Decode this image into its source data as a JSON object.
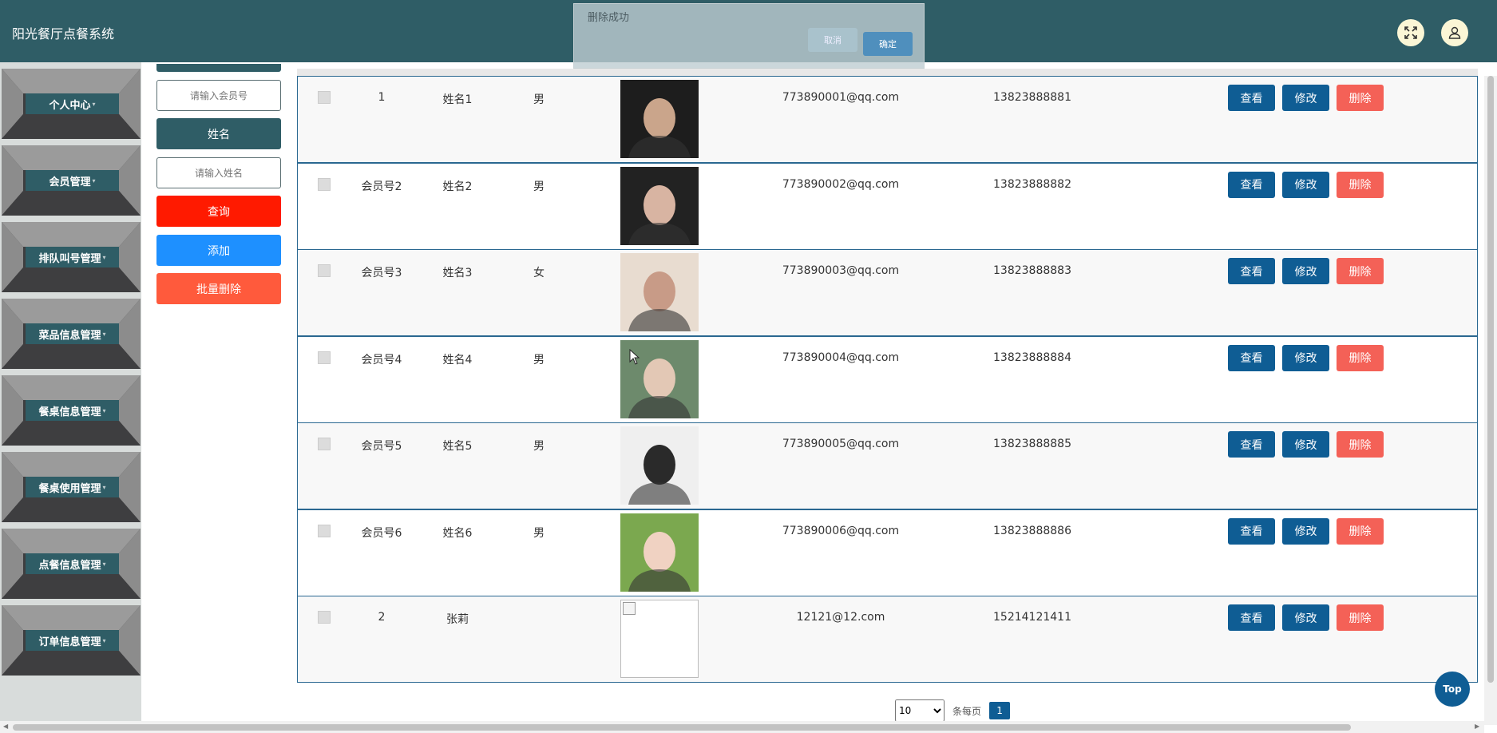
{
  "header": {
    "title": "阳光餐厅点餐系统",
    "icons": [
      "fullscreen-icon",
      "user-icon"
    ]
  },
  "sidebar": {
    "items": [
      {
        "label": "个人中心"
      },
      {
        "label": "会员管理"
      },
      {
        "label": "排队叫号管理"
      },
      {
        "label": "菜品信息管理"
      },
      {
        "label": "餐桌信息管理"
      },
      {
        "label": "餐桌使用管理"
      },
      {
        "label": "点餐信息管理"
      },
      {
        "label": "订单信息管理"
      }
    ]
  },
  "search": {
    "member_placeholder": "请输入会员号",
    "name_label": "姓名",
    "name_placeholder": "请输入姓名",
    "query_label": "查询",
    "add_label": "添加",
    "batch_delete_label": "批量删除"
  },
  "colors": {
    "primary": "#2f5d66",
    "query": "#ff1a00",
    "add": "#1e90ff",
    "batch_delete": "#ff5a3c",
    "action": "#0f5d94",
    "delete": "#f46157"
  },
  "table": {
    "rows": [
      {
        "member_no": "1",
        "name": "姓名1",
        "gender": "男",
        "email": "773890001@qq.com",
        "phone": "13823888881",
        "photo": "person-photo"
      },
      {
        "member_no": "会员号2",
        "name": "姓名2",
        "gender": "男",
        "email": "773890002@qq.com",
        "phone": "13823888882",
        "photo": "person-photo"
      },
      {
        "member_no": "会员号3",
        "name": "姓名3",
        "gender": "女",
        "email": "773890003@qq.com",
        "phone": "13823888883",
        "photo": "person-photo"
      },
      {
        "member_no": "会员号4",
        "name": "姓名4",
        "gender": "男",
        "email": "773890004@qq.com",
        "phone": "13823888884",
        "photo": "person-photo"
      },
      {
        "member_no": "会员号5",
        "name": "姓名5",
        "gender": "男",
        "email": "773890005@qq.com",
        "phone": "13823888885",
        "photo": "person-photo"
      },
      {
        "member_no": "会员号6",
        "name": "姓名6",
        "gender": "男",
        "email": "773890006@qq.com",
        "phone": "13823888886",
        "photo": "person-photo"
      },
      {
        "member_no": "2",
        "name": "张莉",
        "gender": "",
        "email": "12121@12.com",
        "phone": "15214121411",
        "photo": "broken-image"
      }
    ],
    "actions": {
      "view": "查看",
      "edit": "修改",
      "delete": "删除"
    }
  },
  "pagination": {
    "page_size": "10",
    "per_page_label": "条每页",
    "current_page": "1"
  },
  "top_button": "Top",
  "toast": {
    "message": "删除成功",
    "cancel": "取消",
    "confirm": "确定"
  }
}
